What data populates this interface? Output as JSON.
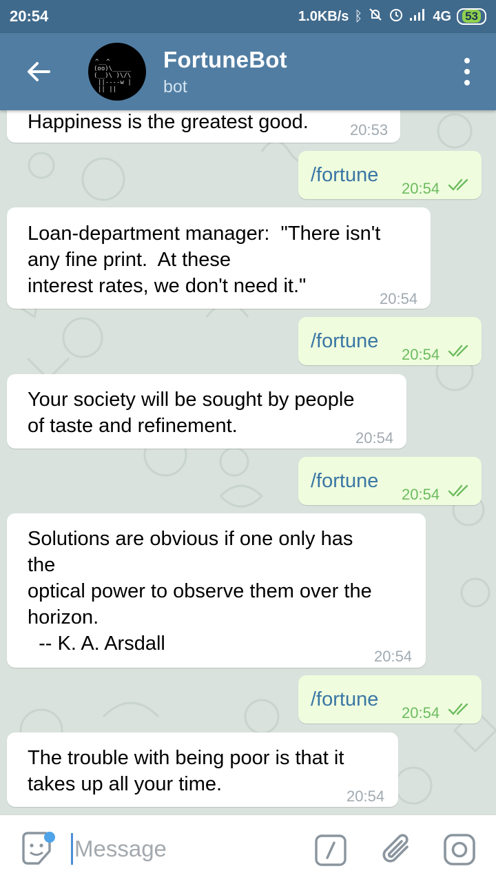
{
  "status_bar": {
    "time": "20:54",
    "net_speed": "1.0KB/s",
    "network": "4G",
    "battery": "53",
    "icons": [
      "bluetooth-icon",
      "mute-icon",
      "alarm-icon",
      "signal-icon"
    ]
  },
  "header": {
    "title": "FortuneBot",
    "subtitle": "bot",
    "back_icon": "arrow-left-icon",
    "menu_icon": "more-vert-icon"
  },
  "messages": [
    {
      "dir": "in",
      "text": "Happiness is the greatest good.",
      "time": "20:53"
    },
    {
      "dir": "out",
      "text": "/fortune",
      "time": "20:54",
      "read": true
    },
    {
      "dir": "in",
      "text": "Loan-department manager:  \"There isn't\nany fine print.  At these\ninterest rates, we don't need it.\"",
      "time": "20:54"
    },
    {
      "dir": "out",
      "text": "/fortune",
      "time": "20:54",
      "read": true
    },
    {
      "dir": "in",
      "text": "Your society will be sought by people\nof taste and refinement.",
      "time": "20:54"
    },
    {
      "dir": "out",
      "text": "/fortune",
      "time": "20:54",
      "read": true
    },
    {
      "dir": "in",
      "text": "Solutions are obvious if one only has\nthe\noptical power to observe them over the\nhorizon.\n  -- K. A. Arsdall",
      "time": "20:54"
    },
    {
      "dir": "out",
      "text": "/fortune",
      "time": "20:54",
      "read": true
    },
    {
      "dir": "in",
      "text": "The trouble with being poor is that it\ntakes up all your time.",
      "time": "20:54"
    }
  ],
  "input_bar": {
    "placeholder": "Message",
    "value": "",
    "icons": [
      "sticker-icon",
      "bot-command-icon",
      "attach-icon",
      "camera-icon"
    ]
  },
  "colors": {
    "status_bar": "#406a8c",
    "header": "#517da2",
    "incoming_bubble": "#ffffff",
    "outgoing_bubble": "#effdde",
    "outgoing_text": "#3a76a4",
    "outgoing_time": "#6dbb5f"
  }
}
